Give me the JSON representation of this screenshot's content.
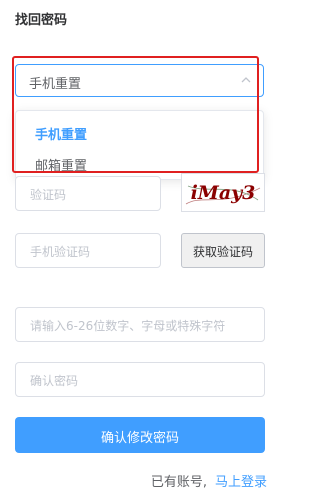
{
  "page": {
    "title": "找回密码"
  },
  "reset_method": {
    "value": "手机重置",
    "options": [
      {
        "label": "手机重置",
        "selected": true
      },
      {
        "label": "邮箱重置",
        "selected": false
      }
    ]
  },
  "form": {
    "captcha_placeholder": "验证码",
    "captcha_image_text": "iMay3",
    "sms_code_placeholder": "手机验证码",
    "get_code_label": "获取验证码",
    "password_placeholder": "请输入6-26位数字、字母或特殊字符",
    "confirm_placeholder": "确认密码",
    "submit_label": "确认修改密码"
  },
  "footer": {
    "text": "已有账号,",
    "login_link": "马上登录"
  },
  "colors": {
    "accent": "#409eff",
    "highlight": "#e02020",
    "captcha_text": "#8b0000"
  },
  "icons": {
    "select_arrow": "chevron-up-icon"
  }
}
